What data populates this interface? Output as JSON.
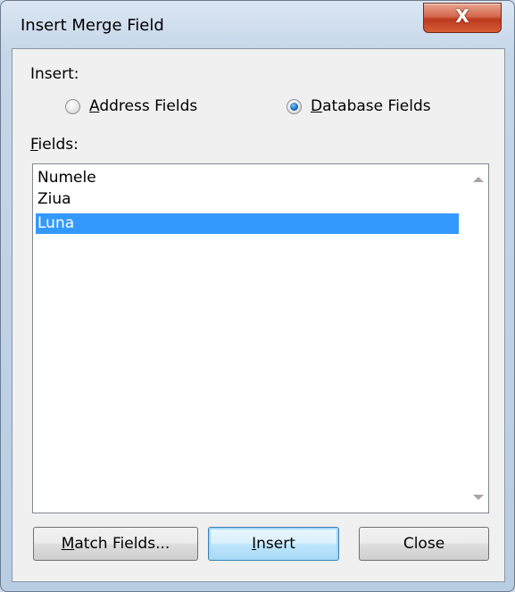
{
  "window": {
    "title": "Insert Merge Field",
    "close_glyph": "X"
  },
  "insert_group": {
    "label": "Insert:",
    "options": [
      {
        "label_mnemonic": "A",
        "label_rest": "ddress Fields",
        "checked": false
      },
      {
        "label_mnemonic": "D",
        "label_rest": "atabase Fields",
        "checked": true
      }
    ]
  },
  "fields": {
    "label_mnemonic": "F",
    "label_rest": "ields:",
    "items": [
      "Numele",
      "Ziua",
      "Luna"
    ],
    "selected_index": 2
  },
  "buttons": {
    "match_fields": {
      "mnemonic": "M",
      "rest": "atch Fields..."
    },
    "insert": {
      "mnemonic": "I",
      "rest": "nsert"
    },
    "close": {
      "label": "Close"
    }
  },
  "colors": {
    "selection": "#3399ff",
    "close_button": "#c9472a",
    "radio_dot": "#1c6fc1"
  }
}
